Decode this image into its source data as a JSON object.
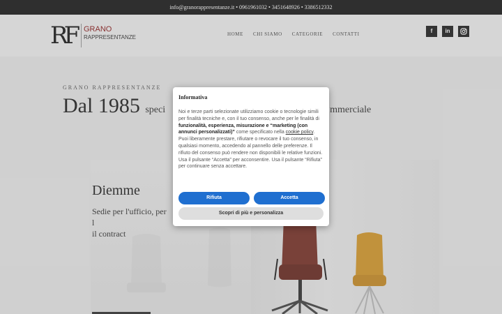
{
  "topbar": {
    "contact": "info@granorappresentanze.it • 0961961032 • 3451648926 • 3386512332"
  },
  "header": {
    "logo_mark": "RF",
    "logo_name": "GRANO",
    "logo_sub": "RAPPRESENTANZE",
    "nav": [
      "HOME",
      "CHI SIAMO",
      "CATEGORIE",
      "CONTATTI"
    ],
    "social": [
      "f",
      "in",
      "ig"
    ]
  },
  "hero": {
    "kicker": "GRANO RAPPRESENTANZE",
    "headline_big": "Dal 1985",
    "headline_small_left": "speci",
    "headline_small_right": "mmerciale",
    "card_title": "Diemme",
    "card_text": "Sedie per l'ufficio, per l",
    "card_text2": "il contract"
  },
  "consent": {
    "title": "Informativa",
    "p1_a": "Noi e terze parti selezionate utilizziamo cookie o tecnologie simili per finalità tecniche e, con il tuo consenso, anche per le finalità di ",
    "p1_b": "funzionalità, esperienza, misurazione e “marketing (con annunci personalizzati)”",
    "p1_c": " come specificato nella ",
    "p1_link": "cookie policy",
    "p1_d": ". Puoi liberamente prestare, rifiutare o revocare il tuo consenso, in qualsiasi momento, accedendo al pannello delle preferenze. Il rifiuto del consenso può rendere non disponibili le relative funzioni.",
    "p2": "Usa il pulsante “Accetta” per acconsentire. Usa il pulsante “Rifiuta” per continuare senza accettare.",
    "reject": "Rifiuta",
    "accept": "Accetta",
    "customize": "Scopri di più e personalizza"
  }
}
